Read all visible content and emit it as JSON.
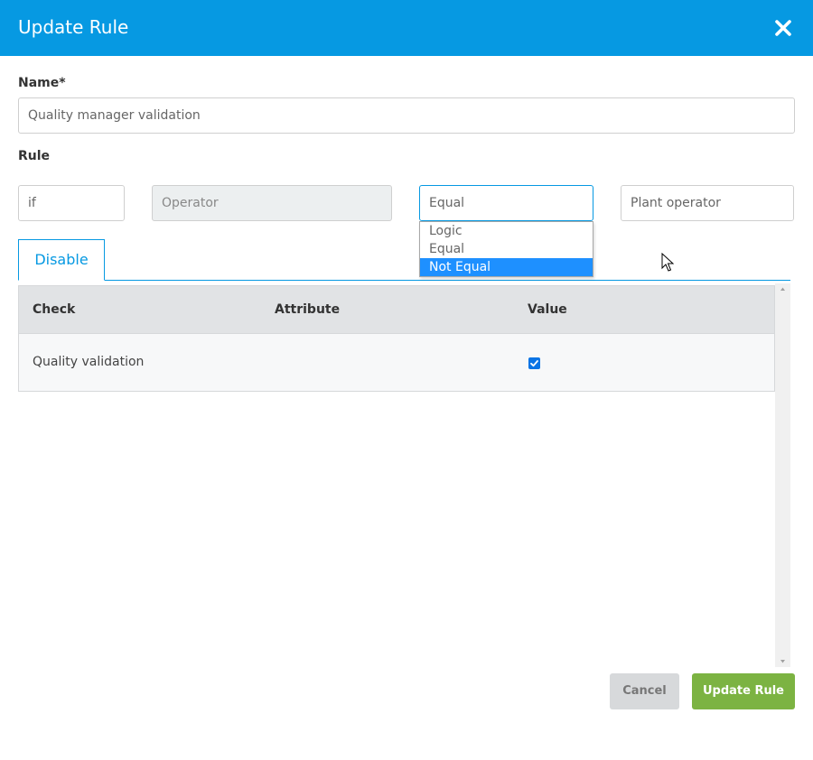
{
  "dialog": {
    "title": "Update Rule",
    "close_icon": "close-icon",
    "header_color": "#0699e2"
  },
  "name_field": {
    "label": "Name*",
    "value": "Quality manager validation"
  },
  "rule": {
    "label": "Rule",
    "condition": "if",
    "operator": "Operator",
    "comparison": "Equal",
    "target": "Plant operator",
    "dropdown_options": [
      {
        "label": "Logic",
        "selected": false
      },
      {
        "label": "Equal",
        "selected": false
      },
      {
        "label": "Not Equal",
        "selected": true
      }
    ]
  },
  "tabs": [
    {
      "label": "Disable",
      "active": true
    }
  ],
  "table": {
    "columns": [
      "Check",
      "Attribute",
      "Value"
    ],
    "rows": [
      {
        "check": "Quality validation",
        "attribute": "",
        "value_checked": true
      }
    ]
  },
  "footer": {
    "cancel_label": "Cancel",
    "update_label": "Update Rule",
    "update_color": "#7cb342"
  }
}
